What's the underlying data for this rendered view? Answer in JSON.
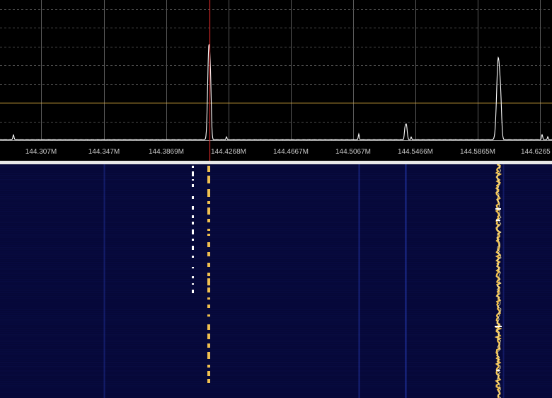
{
  "spectrum_view": {
    "frequency_axis_labels": [
      "144.307M",
      "144.347M",
      "144.3869M",
      "144.4268M",
      "144.4667M",
      "144.5067M",
      "144.5466M",
      "144.5865M",
      "144.6265"
    ],
    "squelch_line_color": "#e0b040",
    "tuned_marker_color": "#d02828",
    "trace_color": "#ffffff",
    "background_color": "#000000"
  },
  "waterfall_view": {
    "background_color": "#060838",
    "signal_colors": [
      "#f0c050",
      "#ffffff",
      "#2a40c0"
    ]
  }
}
